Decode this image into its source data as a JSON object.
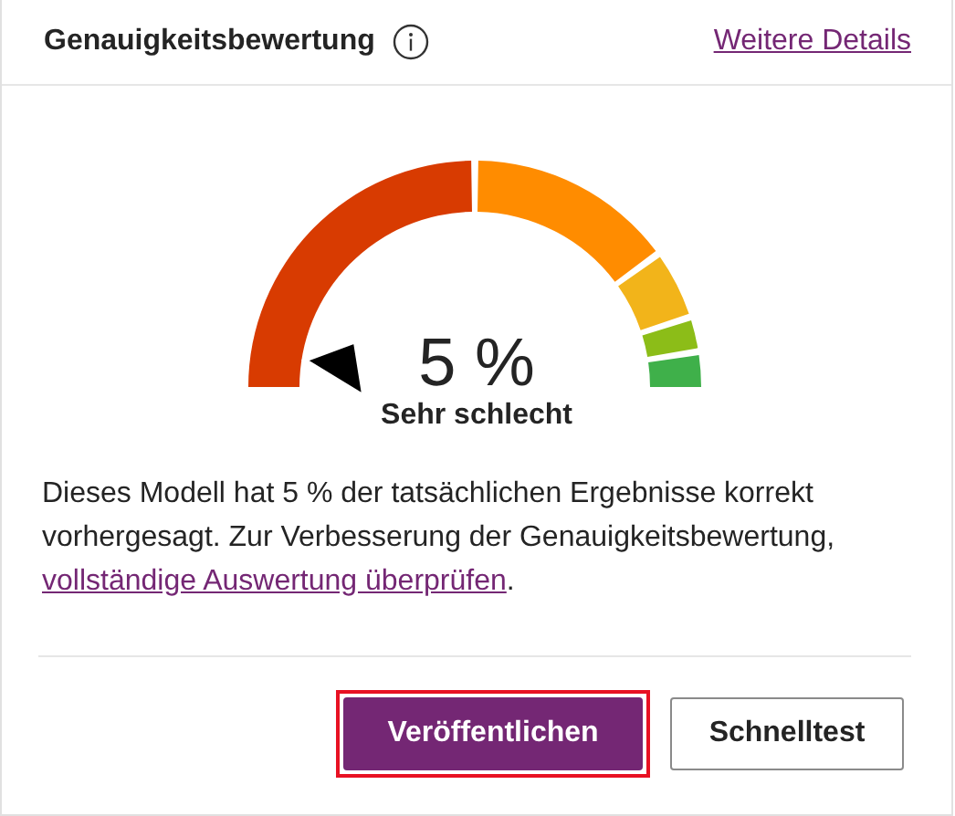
{
  "card": {
    "title": "Genauigkeitsbewertung",
    "details_link": "Weitere Details"
  },
  "gauge": {
    "value": "5 %",
    "rating": "Sehr schlecht",
    "segments": [
      {
        "color": "#d83b01"
      },
      {
        "color": "#ff8c00"
      },
      {
        "color": "#f2b41a"
      },
      {
        "color": "#8cbd18"
      },
      {
        "color": "#3fb04a"
      }
    ]
  },
  "description": {
    "text": "Dieses Modell hat 5 % der tatsächlichen Ergebnisse korrekt vorhergesagt. Zur Verbesserung der Genauigkeitsbewertung,",
    "link": "vollständige Auswertung überprüfen",
    "after": "."
  },
  "buttons": [
    {
      "label": "Veröffentlichen",
      "kind": "primary",
      "highlighted": true
    },
    {
      "label": "Schnelltest",
      "kind": "secondary",
      "highlighted": false
    }
  ]
}
